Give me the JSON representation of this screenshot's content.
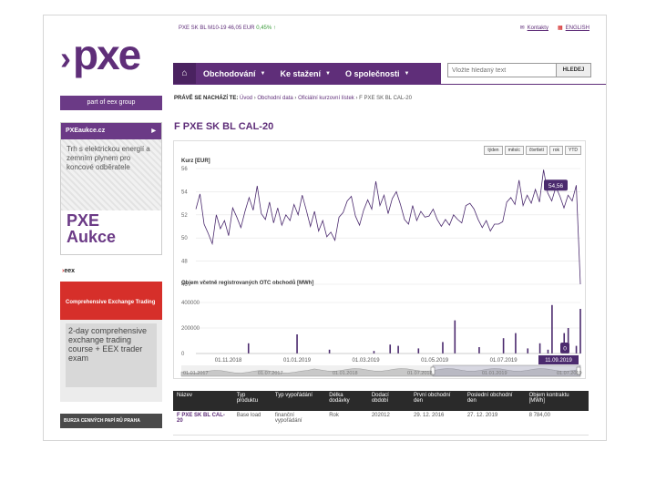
{
  "header": {
    "logo_text": "pxe",
    "ticker_name": "PXE SK BL M10-19",
    "ticker_price": "46,05 EUR",
    "ticker_change": "0,45% ↑",
    "contact_label": "Kontakty",
    "language_label": "ENGLISH"
  },
  "nav": {
    "items": [
      {
        "label": "Obchodování"
      },
      {
        "label": "Ke stažení"
      },
      {
        "label": "O společnosti"
      }
    ]
  },
  "search": {
    "placeholder": "Vložte hledaný text",
    "button_label": "HLEDEJ"
  },
  "sidebar": {
    "group_label": "part of eex group",
    "pxeaukce_label": "PXEaukce.cz",
    "promo_text": "Trh s elektrickou energií a zemním plynem pro koncové odběratele",
    "promo_brand_line1": "PXE",
    "promo_brand_line2": "Aukce",
    "eex_logo_text": "eex",
    "eex_banner_title": "Comprehensive Exchange Trading",
    "eex_banner_text": "2-day comprehensive exchange trading course + EEX trader exam",
    "bottom_link": "BURZA CENNÝCH PAPÍ RŮ PRAHA"
  },
  "breadcrumb": {
    "prefix": "PRÁVĚ SE NACHÁZÍ TE:",
    "items": [
      "Úvod",
      "Obchodní data",
      "Oficiální kurzovní lístek",
      "F PXE SK BL CAL-20"
    ]
  },
  "page_title": "F PXE SK BL CAL-20",
  "range_buttons": [
    "týden",
    "měsíc",
    "čtvrtletí",
    "rok",
    "YTD"
  ],
  "chart_data": [
    {
      "type": "line",
      "title": "Kurz [EUR]",
      "ylim": [
        46,
        56
      ],
      "yticks": [
        46,
        48,
        50,
        52,
        54,
        56
      ],
      "last_value_label": "54,56",
      "values": [
        52.5,
        53.8,
        51.2,
        50.4,
        49.5,
        52.0,
        50.8,
        51.5,
        50.2,
        52.6,
        51.8,
        50.9,
        52.3,
        53.5,
        52.4,
        54.5,
        52.1,
        51.6,
        53.1,
        51.3,
        52.6,
        51.1,
        52.0,
        51.5,
        52.9,
        52.0,
        53.7,
        52.4,
        51.0,
        52.3,
        50.6,
        51.5,
        50.1,
        50.5,
        49.8,
        51.8,
        52.2,
        53.2,
        53.6,
        51.9,
        51.1,
        52.4,
        53.3,
        52.5,
        54.9,
        52.8,
        53.7,
        52.1,
        53.4,
        54.0,
        52.9,
        51.6,
        51.2,
        52.8,
        51.5,
        52.3,
        51.8,
        51.9,
        52.5,
        51.6,
        51.0,
        51.6,
        51.1,
        52.0,
        51.6,
        51.3,
        52.8,
        53.0,
        52.5,
        51.6,
        50.9,
        51.5,
        50.6,
        51.2,
        51.2,
        51.4,
        53.1,
        53.5,
        52.9,
        55.0,
        52.8,
        53.7,
        53.0,
        54.2,
        53.1,
        55.9,
        53.9,
        53.2,
        54.4,
        53.6,
        52.6,
        53.7,
        53.2,
        54.56,
        46.0
      ]
    },
    {
      "type": "bar",
      "title": "Objem včetně registrovaných OTC obchodů [MWh]",
      "ylim": [
        0,
        450000
      ],
      "yticks": [
        0,
        200000,
        400000
      ],
      "ytick_labels": [
        "0",
        "200000",
        "400000"
      ],
      "last_value_label": "0",
      "values": [
        {
          "i": 13,
          "v": 80000
        },
        {
          "i": 25,
          "v": 150000
        },
        {
          "i": 33,
          "v": 30000
        },
        {
          "i": 44,
          "v": 20000
        },
        {
          "i": 48,
          "v": 70000
        },
        {
          "i": 50,
          "v": 60000
        },
        {
          "i": 55,
          "v": 40000
        },
        {
          "i": 61,
          "v": 90000
        },
        {
          "i": 64,
          "v": 260000
        },
        {
          "i": 70,
          "v": 50000
        },
        {
          "i": 76,
          "v": 120000
        },
        {
          "i": 79,
          "v": 160000
        },
        {
          "i": 82,
          "v": 40000
        },
        {
          "i": 85,
          "v": 80000
        },
        {
          "i": 87,
          "v": 30000
        },
        {
          "i": 88,
          "v": 380000
        },
        {
          "i": 91,
          "v": 160000
        },
        {
          "i": 92,
          "v": 200000
        },
        {
          "i": 94,
          "v": 60000
        },
        {
          "i": 95,
          "v": 350000
        }
      ],
      "n": 95,
      "xticks": [
        {
          "i": 8,
          "label": "01.11.2018"
        },
        {
          "i": 25,
          "label": "01.01.2019"
        },
        {
          "i": 42,
          "label": "01.03.2019"
        },
        {
          "i": 59,
          "label": "01.05.2019"
        },
        {
          "i": 76,
          "label": "01.07.2019"
        }
      ],
      "last_date_label": "11.09.2019"
    }
  ],
  "navigator_labels": [
    "01.01.2017",
    "01.07.2017",
    "01.01.2018",
    "01.07.2018",
    "01.01.2019",
    "01.07.2019"
  ],
  "table": {
    "headers": [
      "Název",
      "Typ produktu",
      "Typ vypořádání",
      "Délka dodávky",
      "Dodací období",
      "První obchodní den",
      "Poslední obchodní den",
      "Objem kontraktu [MWh]"
    ],
    "rows": [
      [
        "F PXE SK BL CAL-20",
        "Base load",
        "finanční vypořádání",
        "Rok",
        "202012",
        "29. 12. 2016",
        "27. 12. 2019",
        "8 784,00"
      ]
    ]
  },
  "colors": {
    "brand": "#5f2e79",
    "line": "#4b2a6e",
    "banner_red": "#d62f2a"
  }
}
